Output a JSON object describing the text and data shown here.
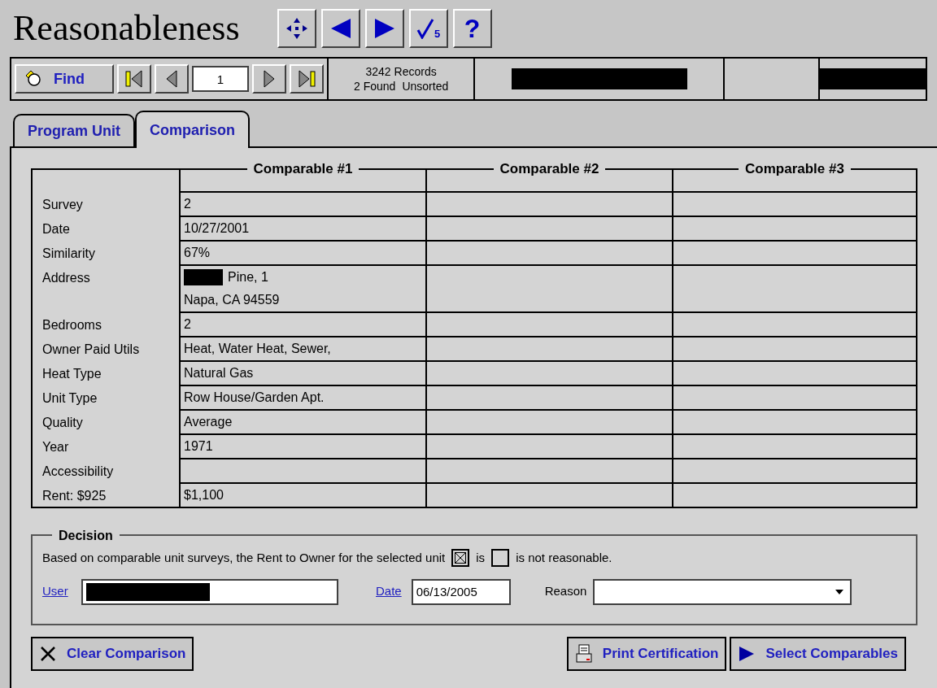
{
  "title": "Reasonableness",
  "title_buttons": [
    {
      "kind": "zoom"
    },
    {
      "kind": "prev"
    },
    {
      "kind": "next"
    },
    {
      "kind": "check",
      "badge": "5"
    },
    {
      "kind": "help",
      "glyph": "?"
    }
  ],
  "toolbar": {
    "find_button": "Find",
    "record_number": "1",
    "records_total": "3242 Records",
    "found": "2 Found",
    "sort_state": "Unsorted",
    "redacted_fields": [
      {
        "redacted": true
      },
      {
        "redacted": false
      },
      {
        "redacted": true
      }
    ]
  },
  "tabs": [
    {
      "label": "Program Unit",
      "selected": false
    },
    {
      "label": "Comparison",
      "selected": true
    }
  ],
  "table": {
    "columns": [
      "Comparable #1",
      "Comparable #2",
      "Comparable #3"
    ],
    "rows": [
      {
        "label": "Survey",
        "cells": [
          {
            "lines": [
              "2"
            ]
          },
          {},
          {}
        ]
      },
      {
        "label": "Date",
        "cells": [
          {
            "lines": [
              "10/27/2001"
            ]
          },
          {},
          {}
        ]
      },
      {
        "label": "Similarity",
        "cells": [
          {
            "lines": [
              "67%"
            ]
          },
          {},
          {}
        ]
      },
      {
        "label": "Address",
        "cells": [
          {
            "lines": [
              "Pine, 1",
              "Napa, CA 94559"
            ],
            "redacted_prefix": true
          },
          {},
          {}
        ]
      },
      {
        "label": "Bedrooms",
        "cells": [
          {
            "lines": [
              "2"
            ]
          },
          {},
          {}
        ]
      },
      {
        "label": "Owner Paid Utils",
        "cells": [
          {
            "lines": [
              "Heat, Water Heat, Sewer,"
            ]
          },
          {},
          {}
        ]
      },
      {
        "label": "Heat Type",
        "cells": [
          {
            "lines": [
              "Natural Gas"
            ]
          },
          {},
          {}
        ]
      },
      {
        "label": "Unit Type",
        "cells": [
          {
            "lines": [
              "Row House/Garden Apt."
            ]
          },
          {},
          {}
        ]
      },
      {
        "label": "Quality",
        "cells": [
          {
            "lines": [
              "Average"
            ]
          },
          {},
          {}
        ]
      },
      {
        "label": "Year",
        "cells": [
          {
            "lines": [
              "1971"
            ]
          },
          {},
          {}
        ]
      },
      {
        "label": "Accessibility",
        "cells": [
          {},
          {},
          {}
        ]
      },
      {
        "label": "Rent:  $925",
        "cells": [
          {
            "lines": [
              "$1,100"
            ]
          },
          {},
          {}
        ]
      }
    ]
  },
  "decision": {
    "legend": "Decision",
    "sentence": "Based on comparable unit surveys, the Rent to Owner for the selected unit",
    "is_label": "is",
    "is_checked": true,
    "is_not_label": "is not reasonable.",
    "is_not_checked": false,
    "user_link": "User",
    "user_redacted": true,
    "date_link": "Date",
    "date_value": "06/13/2005",
    "reason_label": "Reason"
  },
  "buttons": [
    {
      "label": "Clear Comparison",
      "kind": "clear"
    },
    {
      "label": "Print Certification",
      "kind": "print"
    },
    {
      "label": "Select Comparables",
      "kind": "select"
    }
  ]
}
